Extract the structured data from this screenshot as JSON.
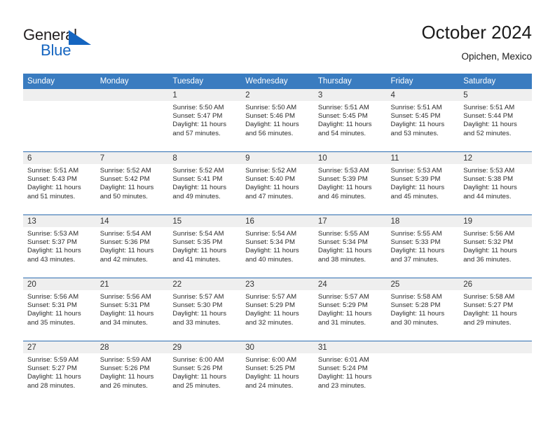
{
  "brand": {
    "name_part1": "General",
    "name_part2": "Blue",
    "logo_icon": "blue-triangle-flag",
    "accent_color": "#1565c0"
  },
  "header": {
    "title": "October 2024",
    "subtitle": "Opichen, Mexico"
  },
  "calendar": {
    "header_bg": "#3a7cc0",
    "row_divider_color": "#2c6cb0",
    "daynum_bg": "#efefef",
    "weekdays": [
      "Sunday",
      "Monday",
      "Tuesday",
      "Wednesday",
      "Thursday",
      "Friday",
      "Saturday"
    ],
    "weeks": [
      [
        {
          "day": "",
          "sunrise": "",
          "sunset": "",
          "daylight1": "",
          "daylight2": ""
        },
        {
          "day": "",
          "sunrise": "",
          "sunset": "",
          "daylight1": "",
          "daylight2": ""
        },
        {
          "day": "1",
          "sunrise": "Sunrise: 5:50 AM",
          "sunset": "Sunset: 5:47 PM",
          "daylight1": "Daylight: 11 hours",
          "daylight2": "and 57 minutes."
        },
        {
          "day": "2",
          "sunrise": "Sunrise: 5:50 AM",
          "sunset": "Sunset: 5:46 PM",
          "daylight1": "Daylight: 11 hours",
          "daylight2": "and 56 minutes."
        },
        {
          "day": "3",
          "sunrise": "Sunrise: 5:51 AM",
          "sunset": "Sunset: 5:45 PM",
          "daylight1": "Daylight: 11 hours",
          "daylight2": "and 54 minutes."
        },
        {
          "day": "4",
          "sunrise": "Sunrise: 5:51 AM",
          "sunset": "Sunset: 5:45 PM",
          "daylight1": "Daylight: 11 hours",
          "daylight2": "and 53 minutes."
        },
        {
          "day": "5",
          "sunrise": "Sunrise: 5:51 AM",
          "sunset": "Sunset: 5:44 PM",
          "daylight1": "Daylight: 11 hours",
          "daylight2": "and 52 minutes."
        }
      ],
      [
        {
          "day": "6",
          "sunrise": "Sunrise: 5:51 AM",
          "sunset": "Sunset: 5:43 PM",
          "daylight1": "Daylight: 11 hours",
          "daylight2": "and 51 minutes."
        },
        {
          "day": "7",
          "sunrise": "Sunrise: 5:52 AM",
          "sunset": "Sunset: 5:42 PM",
          "daylight1": "Daylight: 11 hours",
          "daylight2": "and 50 minutes."
        },
        {
          "day": "8",
          "sunrise": "Sunrise: 5:52 AM",
          "sunset": "Sunset: 5:41 PM",
          "daylight1": "Daylight: 11 hours",
          "daylight2": "and 49 minutes."
        },
        {
          "day": "9",
          "sunrise": "Sunrise: 5:52 AM",
          "sunset": "Sunset: 5:40 PM",
          "daylight1": "Daylight: 11 hours",
          "daylight2": "and 47 minutes."
        },
        {
          "day": "10",
          "sunrise": "Sunrise: 5:53 AM",
          "sunset": "Sunset: 5:39 PM",
          "daylight1": "Daylight: 11 hours",
          "daylight2": "and 46 minutes."
        },
        {
          "day": "11",
          "sunrise": "Sunrise: 5:53 AM",
          "sunset": "Sunset: 5:39 PM",
          "daylight1": "Daylight: 11 hours",
          "daylight2": "and 45 minutes."
        },
        {
          "day": "12",
          "sunrise": "Sunrise: 5:53 AM",
          "sunset": "Sunset: 5:38 PM",
          "daylight1": "Daylight: 11 hours",
          "daylight2": "and 44 minutes."
        }
      ],
      [
        {
          "day": "13",
          "sunrise": "Sunrise: 5:53 AM",
          "sunset": "Sunset: 5:37 PM",
          "daylight1": "Daylight: 11 hours",
          "daylight2": "and 43 minutes."
        },
        {
          "day": "14",
          "sunrise": "Sunrise: 5:54 AM",
          "sunset": "Sunset: 5:36 PM",
          "daylight1": "Daylight: 11 hours",
          "daylight2": "and 42 minutes."
        },
        {
          "day": "15",
          "sunrise": "Sunrise: 5:54 AM",
          "sunset": "Sunset: 5:35 PM",
          "daylight1": "Daylight: 11 hours",
          "daylight2": "and 41 minutes."
        },
        {
          "day": "16",
          "sunrise": "Sunrise: 5:54 AM",
          "sunset": "Sunset: 5:34 PM",
          "daylight1": "Daylight: 11 hours",
          "daylight2": "and 40 minutes."
        },
        {
          "day": "17",
          "sunrise": "Sunrise: 5:55 AM",
          "sunset": "Sunset: 5:34 PM",
          "daylight1": "Daylight: 11 hours",
          "daylight2": "and 38 minutes."
        },
        {
          "day": "18",
          "sunrise": "Sunrise: 5:55 AM",
          "sunset": "Sunset: 5:33 PM",
          "daylight1": "Daylight: 11 hours",
          "daylight2": "and 37 minutes."
        },
        {
          "day": "19",
          "sunrise": "Sunrise: 5:56 AM",
          "sunset": "Sunset: 5:32 PM",
          "daylight1": "Daylight: 11 hours",
          "daylight2": "and 36 minutes."
        }
      ],
      [
        {
          "day": "20",
          "sunrise": "Sunrise: 5:56 AM",
          "sunset": "Sunset: 5:31 PM",
          "daylight1": "Daylight: 11 hours",
          "daylight2": "and 35 minutes."
        },
        {
          "day": "21",
          "sunrise": "Sunrise: 5:56 AM",
          "sunset": "Sunset: 5:31 PM",
          "daylight1": "Daylight: 11 hours",
          "daylight2": "and 34 minutes."
        },
        {
          "day": "22",
          "sunrise": "Sunrise: 5:57 AM",
          "sunset": "Sunset: 5:30 PM",
          "daylight1": "Daylight: 11 hours",
          "daylight2": "and 33 minutes."
        },
        {
          "day": "23",
          "sunrise": "Sunrise: 5:57 AM",
          "sunset": "Sunset: 5:29 PM",
          "daylight1": "Daylight: 11 hours",
          "daylight2": "and 32 minutes."
        },
        {
          "day": "24",
          "sunrise": "Sunrise: 5:57 AM",
          "sunset": "Sunset: 5:29 PM",
          "daylight1": "Daylight: 11 hours",
          "daylight2": "and 31 minutes."
        },
        {
          "day": "25",
          "sunrise": "Sunrise: 5:58 AM",
          "sunset": "Sunset: 5:28 PM",
          "daylight1": "Daylight: 11 hours",
          "daylight2": "and 30 minutes."
        },
        {
          "day": "26",
          "sunrise": "Sunrise: 5:58 AM",
          "sunset": "Sunset: 5:27 PM",
          "daylight1": "Daylight: 11 hours",
          "daylight2": "and 29 minutes."
        }
      ],
      [
        {
          "day": "27",
          "sunrise": "Sunrise: 5:59 AM",
          "sunset": "Sunset: 5:27 PM",
          "daylight1": "Daylight: 11 hours",
          "daylight2": "and 28 minutes."
        },
        {
          "day": "28",
          "sunrise": "Sunrise: 5:59 AM",
          "sunset": "Sunset: 5:26 PM",
          "daylight1": "Daylight: 11 hours",
          "daylight2": "and 26 minutes."
        },
        {
          "day": "29",
          "sunrise": "Sunrise: 6:00 AM",
          "sunset": "Sunset: 5:26 PM",
          "daylight1": "Daylight: 11 hours",
          "daylight2": "and 25 minutes."
        },
        {
          "day": "30",
          "sunrise": "Sunrise: 6:00 AM",
          "sunset": "Sunset: 5:25 PM",
          "daylight1": "Daylight: 11 hours",
          "daylight2": "and 24 minutes."
        },
        {
          "day": "31",
          "sunrise": "Sunrise: 6:01 AM",
          "sunset": "Sunset: 5:24 PM",
          "daylight1": "Daylight: 11 hours",
          "daylight2": "and 23 minutes."
        },
        {
          "day": "",
          "sunrise": "",
          "sunset": "",
          "daylight1": "",
          "daylight2": ""
        },
        {
          "day": "",
          "sunrise": "",
          "sunset": "",
          "daylight1": "",
          "daylight2": ""
        }
      ]
    ]
  }
}
